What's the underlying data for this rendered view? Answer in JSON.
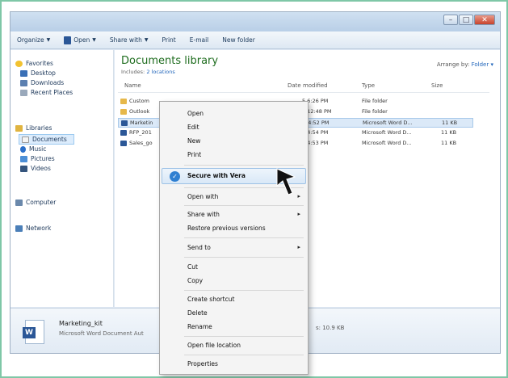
{
  "window": {
    "buttons": [
      "–",
      "□",
      "✕"
    ]
  },
  "toolbar": {
    "organize": "Organize",
    "open": "Open",
    "share_with": "Share with",
    "print": "Print",
    "email": "E-mail",
    "new_folder": "New folder"
  },
  "nav": {
    "favorites": "Favorites",
    "desktop": "Desktop",
    "downloads": "Downloads",
    "recent_places": "Recent Places",
    "libraries": "Libraries",
    "documents": "Documents",
    "music": "Music",
    "pictures": "Pictures",
    "videos": "Videos",
    "computer": "Computer",
    "network": "Network"
  },
  "library": {
    "title": "Documents library",
    "includes_label": "Includes:",
    "includes_link": "2 locations",
    "arrange_label": "Arrange by:",
    "arrange_value": "Folder"
  },
  "columns": {
    "name": "Name",
    "date_modified": "Date modified",
    "type": "Type",
    "size": "Size"
  },
  "files": [
    {
      "name": "Custom",
      "date": "5 6:26 PM",
      "type": "File folder",
      "size": ""
    },
    {
      "name": "Outlook",
      "date": "5 12:48 PM",
      "type": "File folder",
      "size": ""
    },
    {
      "name": "Marketin",
      "date": "5 4:52 PM",
      "type": "Microsoft Word D...",
      "size": "11 KB"
    },
    {
      "name": "RFP_201",
      "date": "5 4:54 PM",
      "type": "Microsoft Word D...",
      "size": "11 KB"
    },
    {
      "name": "Sales_go",
      "date": "5 4:53 PM",
      "type": "Microsoft Word D...",
      "size": "11 KB"
    }
  ],
  "details": {
    "name": "Marketing_kit",
    "type": "Microsoft Word Document",
    "type_suffix": "Aut",
    "size": "s: 10.9 KB"
  },
  "context_menu": {
    "open": "Open",
    "edit": "Edit",
    "new": "New",
    "print": "Print",
    "secure": "Secure with Vera",
    "open_with": "Open with",
    "share_with": "Share with",
    "restore": "Restore previous versions",
    "send_to": "Send to",
    "cut": "Cut",
    "copy": "Copy",
    "create_shortcut": "Create shortcut",
    "delete": "Delete",
    "rename": "Rename",
    "open_location": "Open file location",
    "properties": "Properties"
  },
  "colors": {
    "frame": "#7fc7a7",
    "library_title": "#1f6d1f",
    "link": "#2266bb",
    "check": "#2f7fd1"
  }
}
